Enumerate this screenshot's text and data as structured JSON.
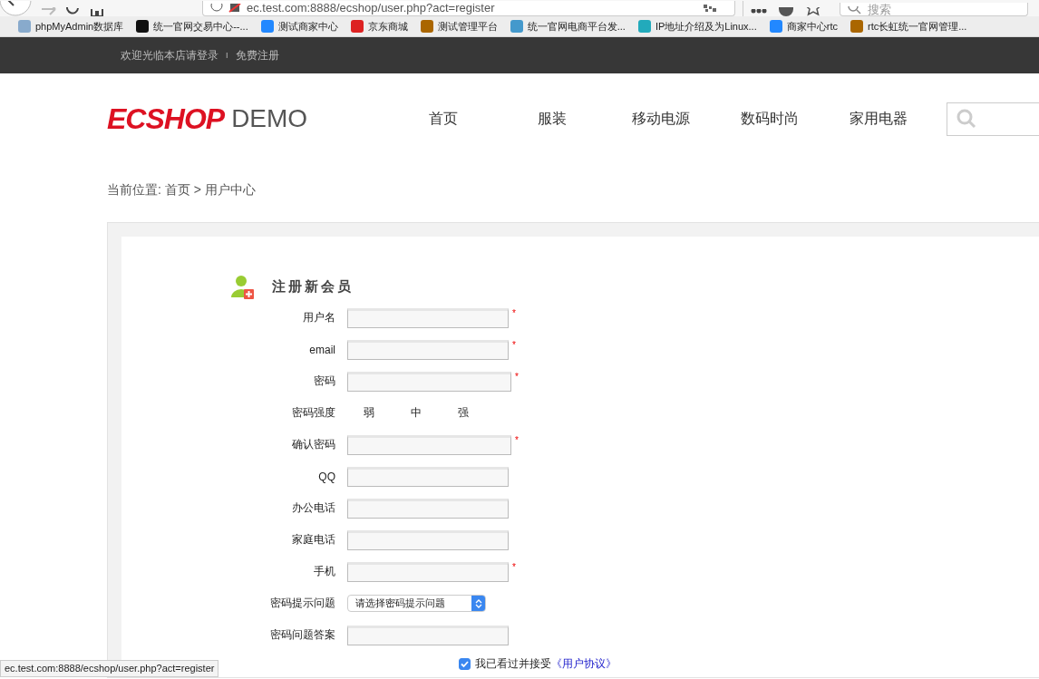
{
  "browser": {
    "url": "ec.test.com:8888/ecshop/user.php?act=register",
    "search_placeholder": "搜索",
    "bookmarks": [
      "phpMyAdmin数据库",
      "统一官网交易中心--...",
      "测试商家中心",
      "京东商城",
      "测试管理平台",
      "统一官网电商平台发...",
      "IP地址介绍及为Linux...",
      "商家中心rtc",
      "rtc长虹统一官网管理..."
    ],
    "status_url": "ec.test.com:8888/ecshop/user.php?act=register"
  },
  "topbar": {
    "welcome": "欢迎光临本店请登录",
    "separator": "I",
    "register_link": "免费注册"
  },
  "header": {
    "logo": "ECSHOP",
    "logo_suffix": "DEMO",
    "nav": [
      {
        "label": "首页"
      },
      {
        "label": "服装"
      },
      {
        "label": "移动电源"
      },
      {
        "label": "数码时尚"
      },
      {
        "label": "家用电器"
      }
    ]
  },
  "breadcrumb": "当前位置: 首页 > 用户中心",
  "form": {
    "title": "注册新会员",
    "required_symbol": "*",
    "rows": [
      {
        "kind": "input",
        "label": "用户名",
        "required": true,
        "wide": false
      },
      {
        "kind": "input",
        "label": "email",
        "required": true,
        "wide": false
      },
      {
        "kind": "input",
        "label": "密码",
        "required": true,
        "wide": true
      },
      {
        "kind": "strength",
        "label": "密码强度",
        "levels": [
          "弱",
          "中",
          "强"
        ]
      },
      {
        "kind": "input",
        "label": "确认密码",
        "required": true,
        "wide": true
      },
      {
        "kind": "input",
        "label": "QQ",
        "required": false,
        "wide": false
      },
      {
        "kind": "input",
        "label": "办公电话",
        "required": false,
        "wide": false
      },
      {
        "kind": "input",
        "label": "家庭电话",
        "required": false,
        "wide": false
      },
      {
        "kind": "input",
        "label": "手机",
        "required": true,
        "wide": false
      },
      {
        "kind": "select",
        "label": "密码提示问题",
        "value": "请选择密码提示问题"
      },
      {
        "kind": "input",
        "label": "密码问题答案",
        "required": false,
        "wide": false
      }
    ],
    "agreement": {
      "checked": true,
      "text": "我已看过并接受",
      "link": "《用户协议》"
    }
  }
}
